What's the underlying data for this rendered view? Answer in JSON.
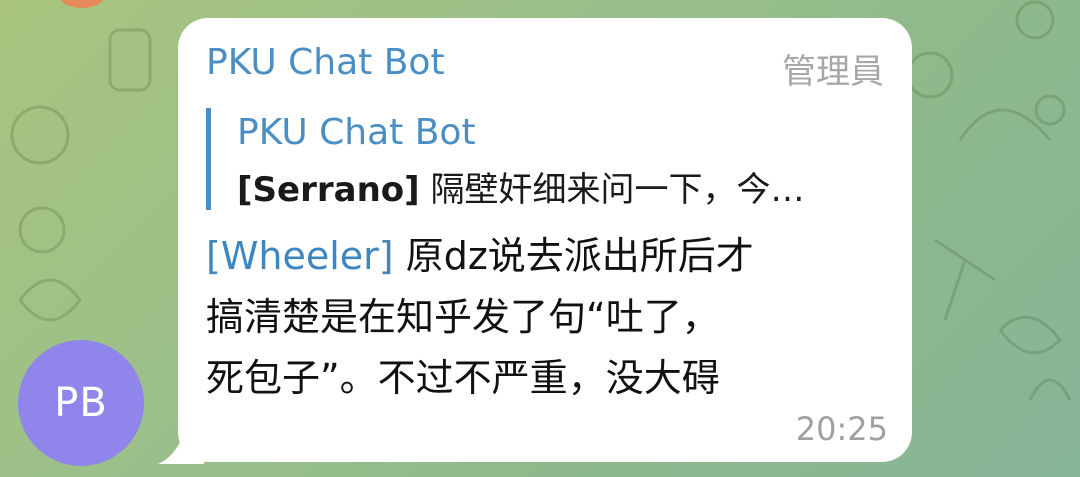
{
  "chat": {
    "message": {
      "sender": "PKU Chat Bot",
      "role_badge": "管理員",
      "reply": {
        "title": "PKU Chat Bot",
        "tag": "[Serrano]",
        "text": " 隔壁奸细来问一下，今…"
      },
      "body_tag": "[Wheeler]",
      "body_lines": [
        " 原dz说去派出所后才",
        "搞清楚是在知乎发了句“吐了，",
        "死包子”。不过不严重，没大碍"
      ],
      "time": "20:25"
    },
    "avatar": {
      "initials": "PB",
      "color": "#8f85ea"
    }
  },
  "colors": {
    "accent": "#4a8ec4",
    "bubble": "#ffffff",
    "wallpaper": "#9cc08a"
  }
}
